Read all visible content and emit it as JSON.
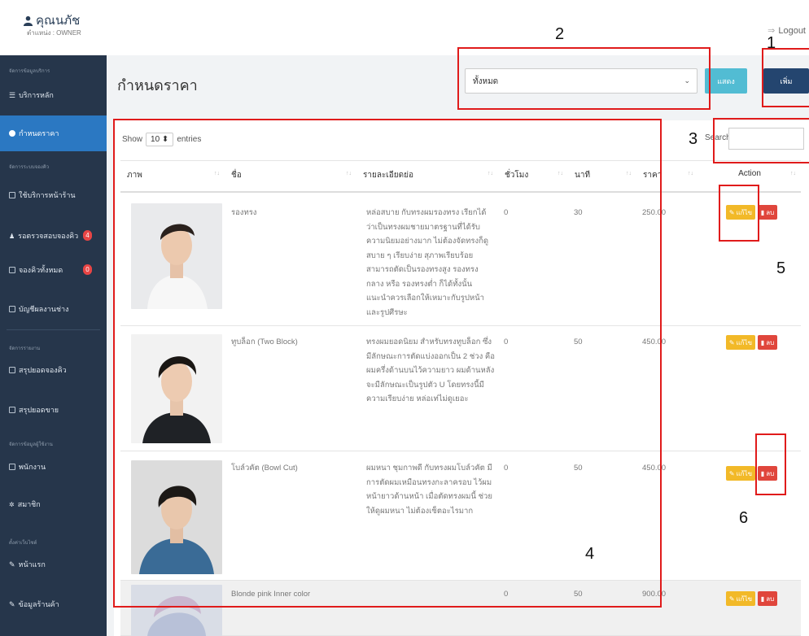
{
  "header": {
    "user_name": "คุณนภัช",
    "role": "ตำแหน่ง : OWNER",
    "logout": "Logout"
  },
  "sidebar": {
    "sections": [
      {
        "label": "จัดการข้อมูลบริการ"
      },
      {
        "label": "จัดการระบบจองคิว"
      },
      {
        "label": "จัดการรายงาน"
      },
      {
        "label": "จัดการข้อมูลผู้ใช้งาน"
      },
      {
        "label": "ตั้งค่าเว็บไซต์"
      }
    ],
    "items": [
      {
        "label": "บริการหลัก"
      },
      {
        "label": "กำหนดราคา"
      },
      {
        "label": "ใช้บริการหน้าร้าน"
      },
      {
        "label": "รอตรวจสอบจองคิว",
        "badge": "4"
      },
      {
        "label": "จองคิวทั้งหมด",
        "badge": "0"
      },
      {
        "label": "บัญชีผลงานช่าง"
      },
      {
        "label": "สรุปยอดจองคิว"
      },
      {
        "label": "สรุปยอดขาย"
      },
      {
        "label": "พนักงาน"
      },
      {
        "label": "สมาชิก"
      },
      {
        "label": "หน้าแรก"
      },
      {
        "label": "ข้อมูลร้านค้า"
      }
    ]
  },
  "page": {
    "title": "กำหนดราคา",
    "filter_value": "ทั้งหมด",
    "show_button": "แสดง",
    "add_button": "เพิ่ม"
  },
  "table_controls": {
    "show": "Show",
    "entries_value": "10",
    "entries": "entries",
    "search_label": "Search:"
  },
  "table": {
    "columns": [
      "ภาพ",
      "ชื่อ",
      "รายละเอียดย่อ",
      "ชั่วโมง",
      "นาที",
      "ราคา",
      "Action"
    ],
    "edit_label": "แก้ไข",
    "delete_label": "ลบ",
    "rows": [
      {
        "name": "รองทรง",
        "desc": "หล่อสบาย กับทรงผมรองทรง เรียกได้ว่าเป็นทรงผมชายมาตรฐานที่ได้รับความนิยมอย่างมาก ไม่ต้องจัดทรงก็ดูสบาย ๆ เรียบง่าย สุภาพเรียบร้อย สามารถตัดเป็นรองทรงสูง รองทรงกลาง หรือ รองทรงต่ำ ก็ได้ทั้งนั้น แนะนำควรเลือกให้เหมาะกับรูปหน้าและรูปศีรษะ",
        "hours": "0",
        "minutes": "30",
        "price": "250.00"
      },
      {
        "name": "ทูบล็อก (Two Block)",
        "desc": "ทรงผมยอดนิยม สำหรับทรงทูบล็อก ซึ่งมีลักษณะการตัดแบ่งออกเป็น 2 ช่วง คือผมครึ่งด้านบนไว้ความยาว ผมด้านหลังจะมีลักษณะเป็นรูปตัว U โดยทรงนี้มีความเรียบง่าย หล่อเท่ไม่ดูเยอะ",
        "hours": "0",
        "minutes": "50",
        "price": "450.00"
      },
      {
        "name": "โบล์วคัต (Bowl Cut)",
        "desc": "ผมหนา ชุมกาพดี กับทรงผมโบล์วคัต มีการตัดผมเหมือนทรงกะลาครอบ ไว้ผมหน้ายาวด้านหน้า เมื่อตัดทรงผมนี้ ช่วยให้ดูผมหนา ไม่ต้องเซ็ตอะไรมาก",
        "hours": "0",
        "minutes": "50",
        "price": "450.00"
      },
      {
        "name": "Blonde pink Inner color",
        "desc": "",
        "hours": "0",
        "minutes": "50",
        "price": "900.00"
      }
    ]
  },
  "annotations": [
    "1",
    "2",
    "3",
    "4",
    "5",
    "6"
  ],
  "colors": {
    "sidebar": "#26364b",
    "active": "#2b78c2",
    "show_btn": "#52bcd3",
    "add_btn": "#24456f",
    "edit_btn": "#f2b928",
    "delete_btn": "#e0463c",
    "annotation": "#e01b1b"
  }
}
